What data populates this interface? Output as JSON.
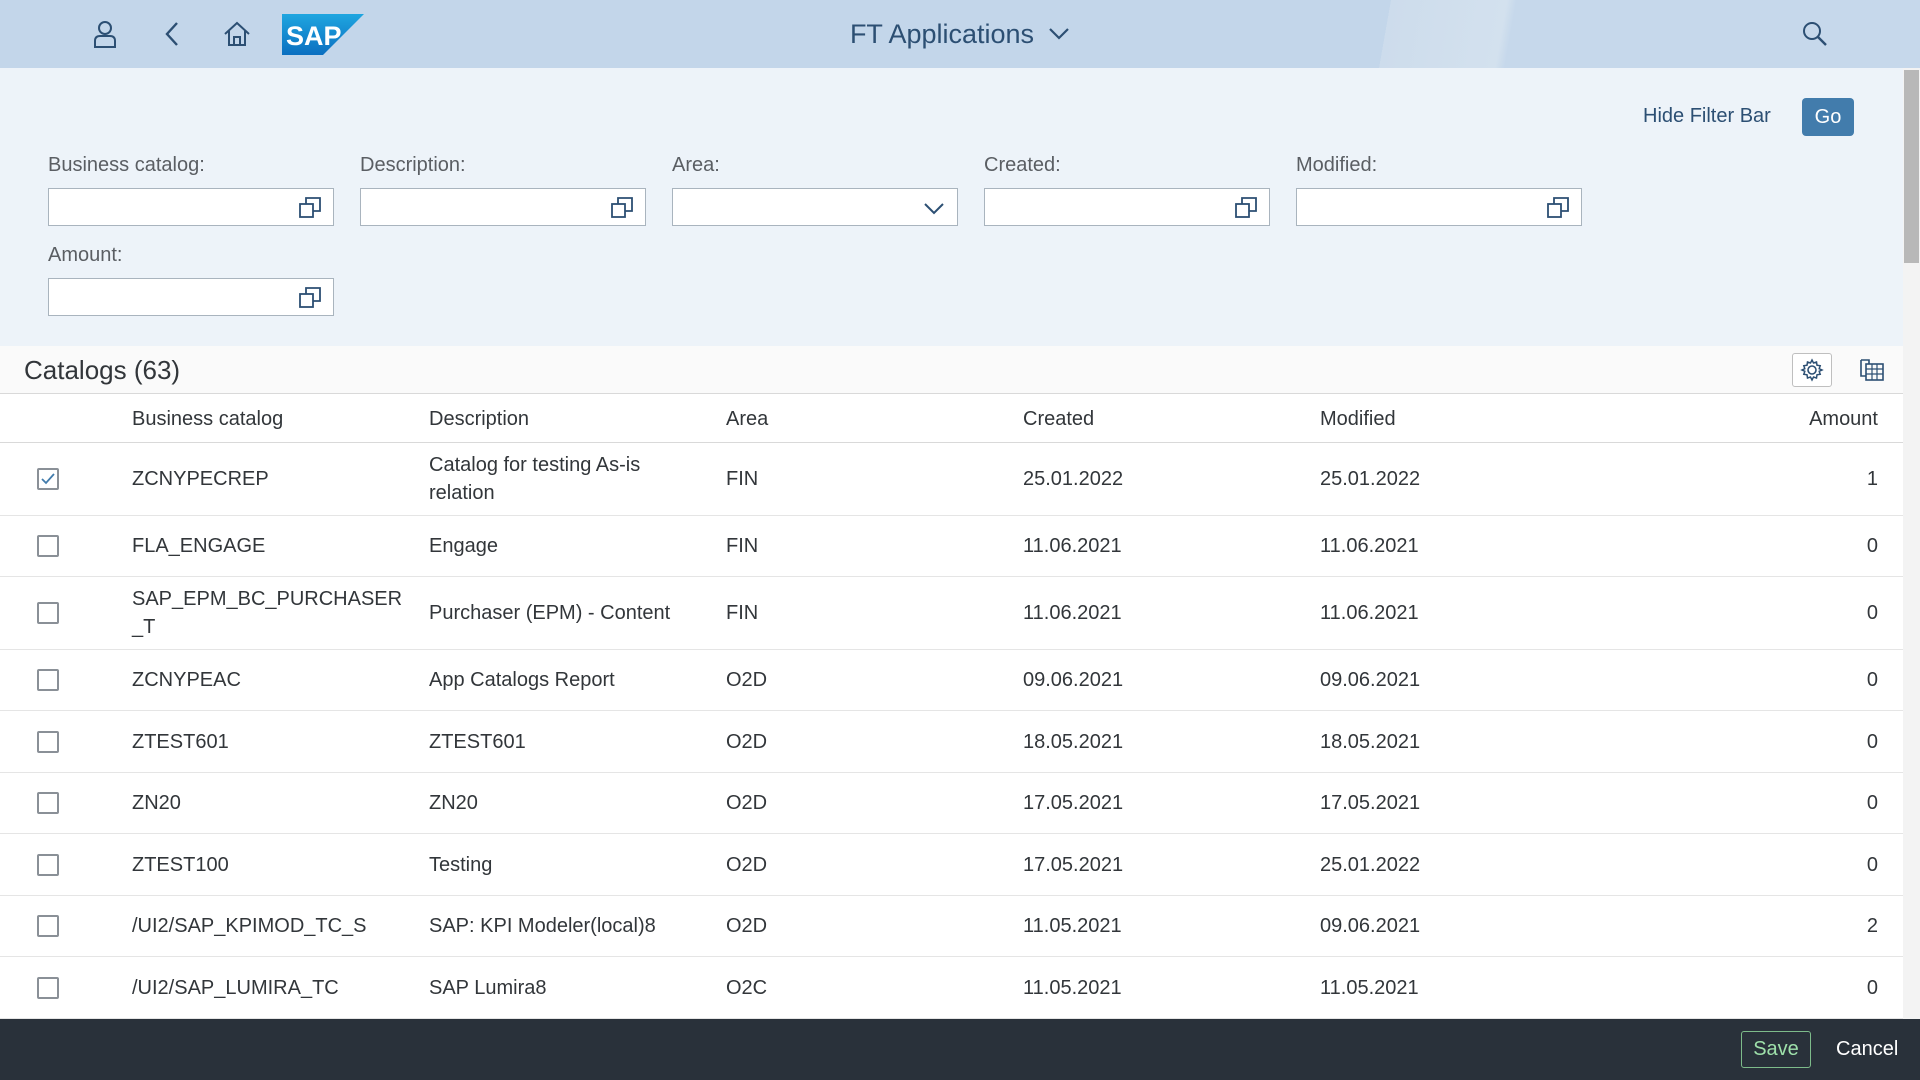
{
  "shell": {
    "title": "FT Applications",
    "icons": [
      "user-icon",
      "back-icon",
      "home-icon",
      "search-icon"
    ],
    "logo_text": "SAP",
    "colors": {
      "header_bg": "#c3d6ea",
      "title": "#2c4f73"
    }
  },
  "filterbar": {
    "hide_label": "Hide Filter Bar",
    "go_label": "Go",
    "fields": [
      {
        "label": "Business catalog:",
        "value": "",
        "control": "value-help"
      },
      {
        "label": "Description:",
        "value": "",
        "control": "value-help"
      },
      {
        "label": "Area:",
        "value": "",
        "control": "dropdown"
      },
      {
        "label": "Created:",
        "value": "",
        "control": "value-help"
      },
      {
        "label": "Modified:",
        "value": "",
        "control": "value-help"
      },
      {
        "label": "Amount:",
        "value": "",
        "control": "value-help"
      }
    ]
  },
  "table": {
    "title": "Catalogs (63)",
    "columns": [
      "Business catalog",
      "Description",
      "Area",
      "Created",
      "Modified",
      "Amount"
    ],
    "rows": [
      {
        "selected": true,
        "catalog": "ZCNYPECREP",
        "description": "Catalog for testing As-is relation",
        "area": "FIN",
        "created": "25.01.2022",
        "modified": "25.01.2022",
        "amount": "1"
      },
      {
        "selected": false,
        "catalog": "FLA_ENGAGE",
        "description": "Engage",
        "area": "FIN",
        "created": "11.06.2021",
        "modified": "11.06.2021",
        "amount": "0"
      },
      {
        "selected": false,
        "catalog": "SAP_EPM_BC_PURCHASER_T",
        "description": "Purchaser (EPM) - Content",
        "area": "FIN",
        "created": "11.06.2021",
        "modified": "11.06.2021",
        "amount": "0"
      },
      {
        "selected": false,
        "catalog": "ZCNYPEAC",
        "description": "App Catalogs Report",
        "area": "O2D",
        "created": "09.06.2021",
        "modified": "09.06.2021",
        "amount": "0"
      },
      {
        "selected": false,
        "catalog": "ZTEST601",
        "description": "ZTEST601",
        "area": "O2D",
        "created": "18.05.2021",
        "modified": "18.05.2021",
        "amount": "0"
      },
      {
        "selected": false,
        "catalog": "ZN20",
        "description": "ZN20",
        "area": "O2D",
        "created": "17.05.2021",
        "modified": "17.05.2021",
        "amount": "0"
      },
      {
        "selected": false,
        "catalog": "ZTEST100",
        "description": "Testing",
        "area": "O2D",
        "created": "17.05.2021",
        "modified": "25.01.2022",
        "amount": "0"
      },
      {
        "selected": false,
        "catalog": "/UI2/SAP_KPIMOD_TC_S",
        "description": "SAP: KPI Modeler(local)8",
        "area": "O2D",
        "created": "11.05.2021",
        "modified": "09.06.2021",
        "amount": "2"
      },
      {
        "selected": false,
        "catalog": "/UI2/SAP_LUMIRA_TC",
        "description": "SAP Lumira8",
        "area": "O2C",
        "created": "11.05.2021",
        "modified": "11.05.2021",
        "amount": "0"
      }
    ]
  },
  "footer": {
    "save_label": "Save",
    "cancel_label": "Cancel"
  }
}
